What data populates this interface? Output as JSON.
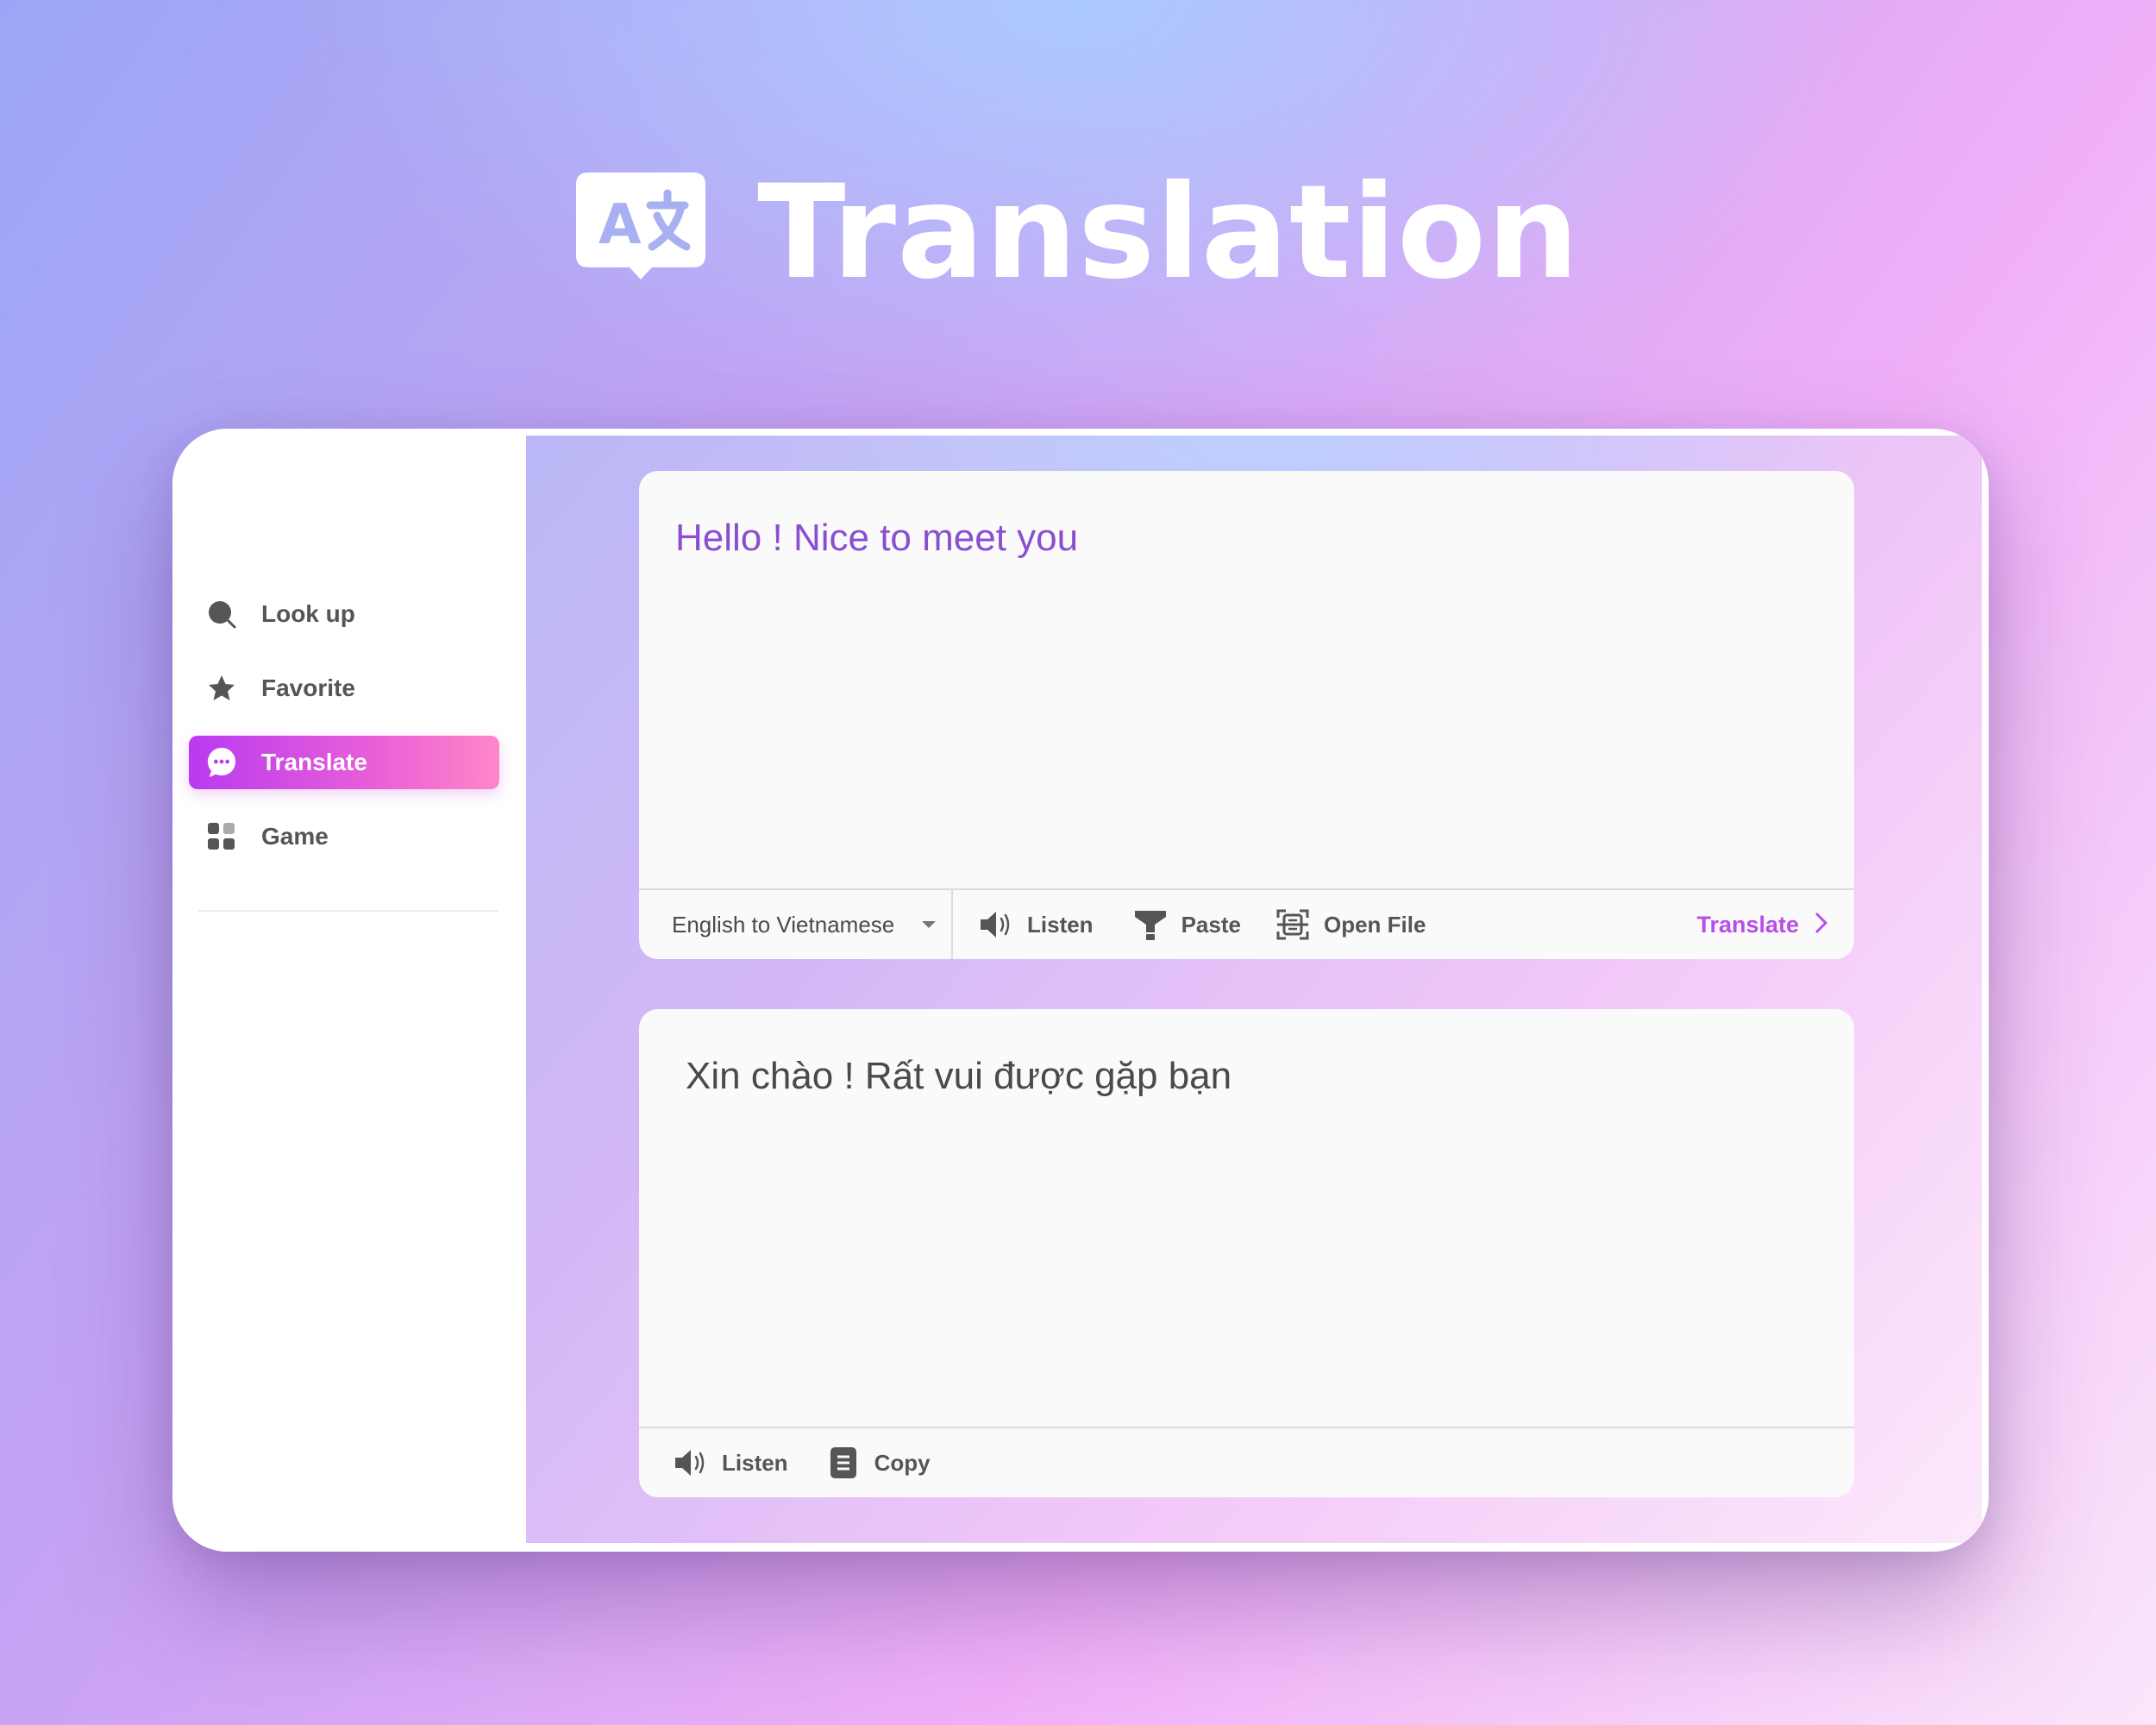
{
  "hero": {
    "title": "Translation",
    "icon": "translate-bubble-icon"
  },
  "sidebar": {
    "items": [
      {
        "label": "Look up",
        "icon": "search-icon",
        "active": false
      },
      {
        "label": "Favorite",
        "icon": "star-icon",
        "active": false
      },
      {
        "label": "Translate",
        "icon": "chat-bubble-icon",
        "active": true
      },
      {
        "label": "Game",
        "icon": "grid-icon",
        "active": false
      }
    ]
  },
  "source": {
    "text": "Hello ! Nice to meet you",
    "language_pair": "English to Vietnamese",
    "listen_label": "Listen",
    "paste_label": "Paste",
    "open_file_label": "Open File",
    "translate_label": "Translate"
  },
  "target": {
    "text": "Xin chào ! Rất vui được gặp bạn",
    "listen_label": "Listen",
    "copy_label": "Copy"
  },
  "colors": {
    "accent_purple": "#b84ee8",
    "active_gradient_start": "#b93af0",
    "active_gradient_end": "#ff86c8",
    "source_text": "#8a4fd0",
    "icon_gray": "#555555"
  }
}
